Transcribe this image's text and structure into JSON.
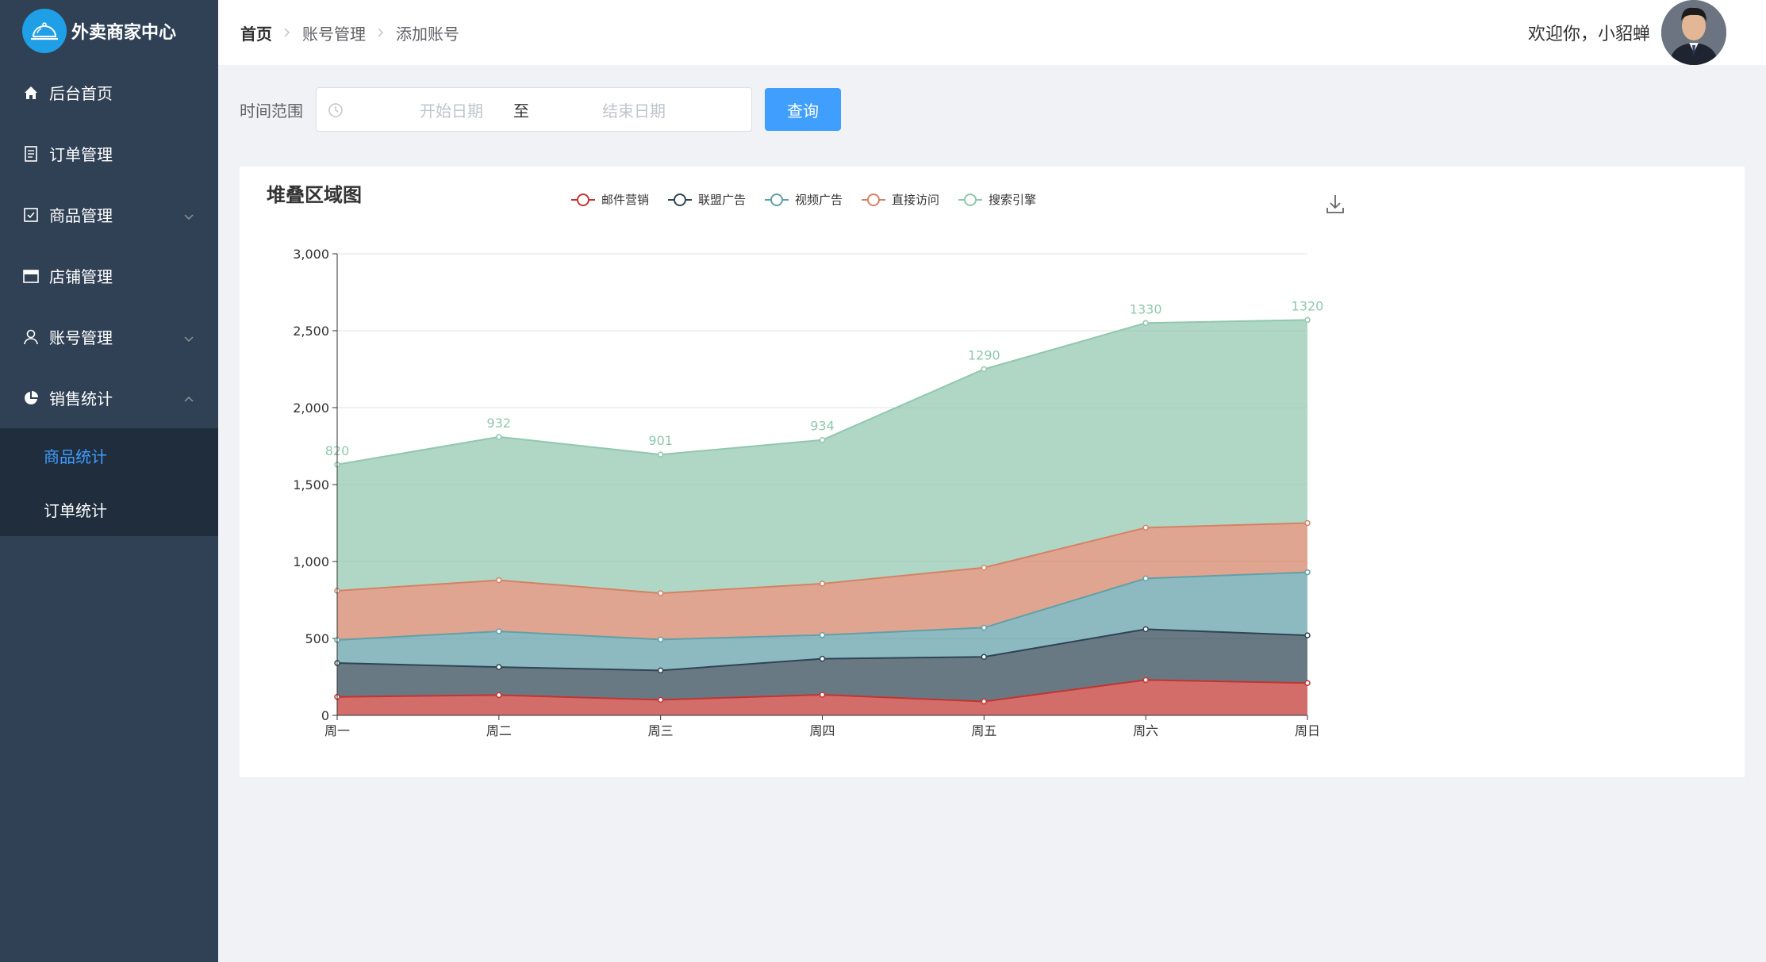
{
  "app": {
    "title": "外卖商家中心"
  },
  "sidebar": {
    "items": [
      {
        "label": "后台首页",
        "icon": "home-icon"
      },
      {
        "label": "订单管理",
        "icon": "document-icon"
      },
      {
        "label": "商品管理",
        "icon": "checklist-icon",
        "chevron": "down"
      },
      {
        "label": "店铺管理",
        "icon": "shop-icon"
      },
      {
        "label": "账号管理",
        "icon": "user-icon",
        "chevron": "down"
      },
      {
        "label": "销售统计",
        "icon": "pie-chart-icon",
        "chevron": "up"
      }
    ],
    "submenu": [
      {
        "label": "商品统计",
        "active": true
      },
      {
        "label": "订单统计",
        "active": false
      }
    ]
  },
  "header": {
    "breadcrumb": [
      "首页",
      "账号管理",
      "添加账号"
    ],
    "welcome": "欢迎你，小貂蝉"
  },
  "filter": {
    "label": "时间范围",
    "start_placeholder": "开始日期",
    "separator": "至",
    "end_placeholder": "结束日期",
    "query_button": "查询"
  },
  "chart_data": {
    "type": "area",
    "stacked": true,
    "title": "堆叠区域图",
    "categories": [
      "周一",
      "周二",
      "周三",
      "周四",
      "周五",
      "周六",
      "周日"
    ],
    "ylim": [
      0,
      3000
    ],
    "yticks": [
      0,
      500,
      1000,
      1500,
      2000,
      2500,
      3000
    ],
    "ytick_labels": [
      "0",
      "500",
      "1,000",
      "1,500",
      "2,000",
      "2,500",
      "3,000"
    ],
    "legend_position": "top",
    "grid": true,
    "series": [
      {
        "name": "邮件营销",
        "color": "#c23531",
        "values": [
          120,
          132,
          101,
          134,
          90,
          230,
          210
        ]
      },
      {
        "name": "联盟广告",
        "color": "#2f4554",
        "values": [
          220,
          182,
          191,
          234,
          290,
          330,
          310
        ]
      },
      {
        "name": "视频广告",
        "color": "#61a0a8",
        "values": [
          150,
          232,
          201,
          154,
          190,
          330,
          410
        ]
      },
      {
        "name": "直接访问",
        "color": "#d48265",
        "values": [
          320,
          332,
          301,
          334,
          390,
          330,
          320
        ]
      },
      {
        "name": "搜索引擎",
        "color": "#91c7ae",
        "values": [
          820,
          932,
          901,
          934,
          1290,
          1330,
          1320
        ],
        "show_labels": true
      }
    ]
  }
}
